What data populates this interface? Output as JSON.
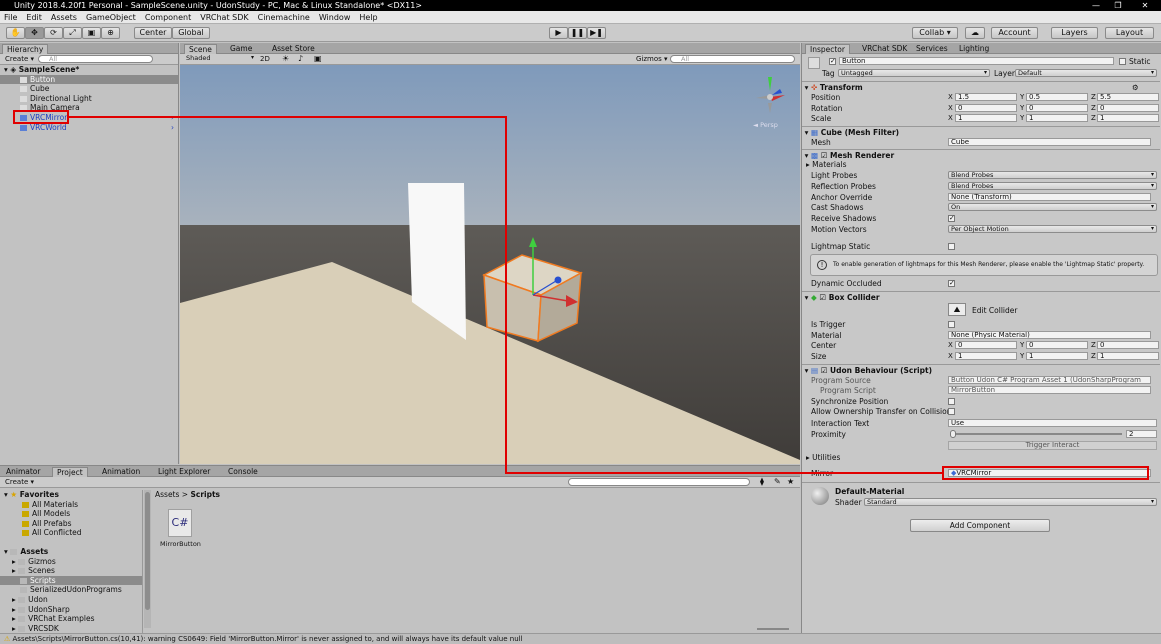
{
  "window": {
    "title": "Unity 2018.4.20f1 Personal - SampleScene.unity - UdonStudy - PC, Mac & Linux Standalone* <DX11>",
    "minimize": "—",
    "maximize": "❐",
    "close": "✕"
  },
  "menu": [
    "File",
    "Edit",
    "Assets",
    "GameObject",
    "Component",
    "VRChat SDK",
    "Cinemachine",
    "Window",
    "Help"
  ],
  "toolbar": {
    "center": "Center",
    "global": "Global",
    "collab": "Collab ▾",
    "account": "Account",
    "layers": "Layers",
    "layout": "Layout",
    "play": "▶",
    "pause": "❚❚",
    "step": "▶❚"
  },
  "hierarchy": {
    "tab": "Hierarchy",
    "create": "Create ▾",
    "search": "All",
    "scene": "SampleScene*",
    "items": [
      "Button",
      "Cube",
      "Directional Light",
      "Main Camera",
      "VRCMirror",
      "VRCWorld"
    ]
  },
  "scene": {
    "tabs": [
      "Scene",
      "Game",
      "Asset Store"
    ],
    "shading": "Shaded",
    "mode2d": "2D",
    "gizmos": "Gizmos ▾",
    "search": "All",
    "persp": "◄ Persp"
  },
  "project": {
    "tabs": [
      "Animator",
      "Project",
      "Animation",
      "Light Explorer",
      "Console"
    ],
    "create": "Create ▾",
    "favorites_label": "Favorites",
    "favorites": [
      "All Materials",
      "All Models",
      "All Prefabs",
      "All Conflicted"
    ],
    "assets_label": "Assets",
    "assets": [
      "Gizmos",
      "Scenes",
      "Scripts",
      "SerializedUdonPrograms",
      "Udon",
      "UdonSharp",
      "VRChat Examples",
      "VRCSDK"
    ],
    "breadcrumb": [
      "Assets",
      "Scripts"
    ],
    "file_name": "MirrorButton",
    "file_icon": "C#"
  },
  "inspector": {
    "tabs": [
      "Inspector",
      "VRChat SDK",
      "Services",
      "Lighting"
    ],
    "object_name": "Button",
    "static": "Static",
    "tag_label": "Tag",
    "tag": "Untagged",
    "layer_label": "Layer",
    "layer": "Default",
    "transform": {
      "title": "Transform",
      "position_label": "Position",
      "rotation_label": "Rotation",
      "scale_label": "Scale",
      "position": [
        "1.5",
        "0.5",
        "5.5"
      ],
      "rotation": [
        "0",
        "0",
        "0"
      ],
      "scale": [
        "1",
        "1",
        "1"
      ]
    },
    "mesh_filter": {
      "title": "Cube (Mesh Filter)",
      "mesh_label": "Mesh",
      "mesh": "Cube"
    },
    "mesh_renderer": {
      "title": "Mesh Renderer",
      "materials": "Materials",
      "light_probes_label": "Light Probes",
      "light_probes": "Blend Probes",
      "reflection_label": "Reflection Probes",
      "reflection": "Blend Probes",
      "anchor_label": "Anchor Override",
      "anchor": "None (Transform)",
      "cast_label": "Cast Shadows",
      "cast": "On",
      "receive_label": "Receive Shadows",
      "motion_label": "Motion Vectors",
      "motion": "Per Object Motion",
      "lightmap_label": "Lightmap Static",
      "info": "To enable generation of lightmaps for this Mesh Renderer, please enable the 'Lightmap Static' property.",
      "occluded_label": "Dynamic Occluded"
    },
    "box_collider": {
      "title": "Box Collider",
      "edit": "Edit Collider",
      "trigger_label": "Is Trigger",
      "material_label": "Material",
      "material": "None (Physic Material)",
      "center_label": "Center",
      "size_label": "Size",
      "center": [
        "0",
        "0",
        "0"
      ],
      "size": [
        "1",
        "1",
        "1"
      ]
    },
    "udon": {
      "title": "Udon Behaviour (Script)",
      "program_source_label": "Program Source",
      "program_source": "Button Udon C# Program Asset 1 (UdonSharpProgram",
      "program_script_label": "Program Script",
      "program_script": "MirrorButton",
      "sync_label": "Synchronize Position",
      "ownership_label": "Allow Ownership Transfer on Collision",
      "interaction_label": "Interaction Text",
      "interaction": "Use",
      "proximity_label": "Proximity",
      "proximity": "2",
      "proximity_fraction": 0.02,
      "trigger_interact": "Trigger Interact",
      "utilities": "Utilities",
      "mirror_label": "Mirror",
      "mirror": "VRCMirror"
    },
    "material": {
      "name": "Default-Material",
      "shader_label": "Shader",
      "shader": "Standard"
    },
    "add_component": "Add Component"
  },
  "status": "Assets\\Scripts\\MirrorButton.cs(10,41): warning CS0649: Field 'MirrorButton.Mirror' is never assigned to, and will always have its default value null",
  "colors": {
    "highlight": "#e00000",
    "sky": "#8aa4c2",
    "floor": "#d6cbb4",
    "selection": "#8b8b8b"
  }
}
